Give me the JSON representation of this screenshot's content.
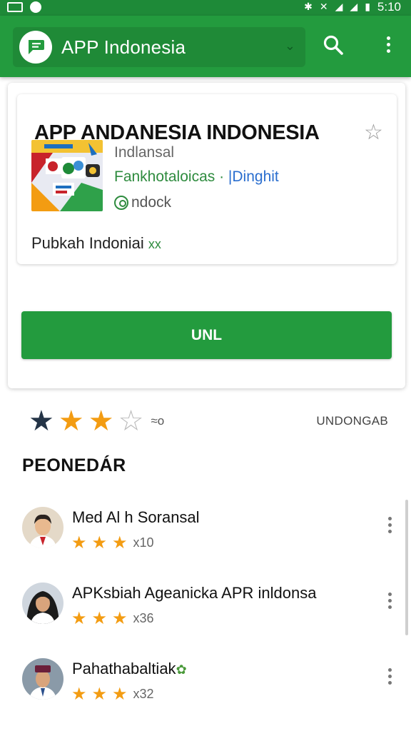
{
  "status_bar": {
    "time": "5:10"
  },
  "app_bar": {
    "title": "APP Indonesia",
    "icons": [
      "chat-logo-icon",
      "chevron-down-icon",
      "search-icon",
      "more-vert-icon"
    ]
  },
  "app_card": {
    "name": "APP ANDANESIA INDONESIA",
    "developer": "Indlansal",
    "category": "Fankhotaloicas",
    "category_separator": " · ",
    "category_link": "|Dinghit",
    "downloads": "ndock",
    "publisher": "Pubkah Indoniai",
    "publisher_badge": "xx",
    "install_label": "UNL"
  },
  "rating": {
    "stars_filled": 3,
    "stars_total": 4,
    "count": "≈o",
    "right_label": "UNDONGAB"
  },
  "reviews_title": "PEONEDÁR",
  "reviews": [
    {
      "name": "Med Al h Soransal",
      "rating": 3,
      "count": "x10"
    },
    {
      "name": "APKsbiah Ageanicka  APR inldonsa",
      "rating": 3,
      "count": "x36"
    },
    {
      "name": "Pahathabaltiak",
      "rating": 3,
      "count": "x32"
    }
  ],
  "colors": {
    "primary": "#239b3e",
    "primary_dark": "#1e8a38",
    "star": "#f39c12",
    "star_dark": "#243447"
  }
}
